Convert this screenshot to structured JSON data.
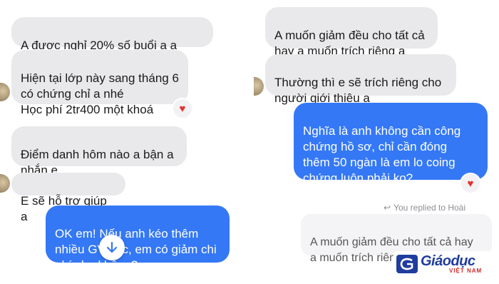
{
  "left": {
    "messages": [
      {
        "text": "A được nghỉ 20% số buổi a ạ"
      },
      {
        "text": "Hiện tại lớp này sang tháng 6\ncó chứng chỉ a nhé\nHọc phí 2tr400 một khoá"
      },
      {
        "text": "Điểm danh hôm nào a bận a\nnhắn e"
      },
      {
        "text": "E sẽ hỗ trợ giúp a"
      },
      {
        "text": "OK em! Nếu anh kéo thêm\nnhiều GV học, em có giảm chi\nphí cho       không?"
      }
    ]
  },
  "right": {
    "messages": [
      {
        "text": "A muốn giảm đều cho tất cả\nhay a muốn trích riêng ạ"
      },
      {
        "text": "Thường thì e sẽ trích riêng cho\nngười giới thiệu ạ"
      },
      {
        "text": "Nghĩa là anh không cần công\nchứng hồ sơ, chỉ cần đóng\nthêm 50 ngàn là em lo coing\nchứng luôn phải ko?"
      }
    ],
    "replied_label": "You replied to Hoài",
    "quoted_text": "A muốn giảm đều cho tất cả hay\na muốn trích riêng ạ"
  },
  "watermark": {
    "logo_text": "Giáodục",
    "sub_text": "VIỆT NAM"
  },
  "colors": {
    "incoming_bubble": "#e9e9ec",
    "outgoing_bubble": "#3478f6",
    "heart": "#e8322f",
    "watermark_blue": "#1f3c9e",
    "watermark_red": "#d42a2a"
  },
  "icons": [
    "heart-icon",
    "arrow-down-icon",
    "reply-arrow-icon"
  ]
}
